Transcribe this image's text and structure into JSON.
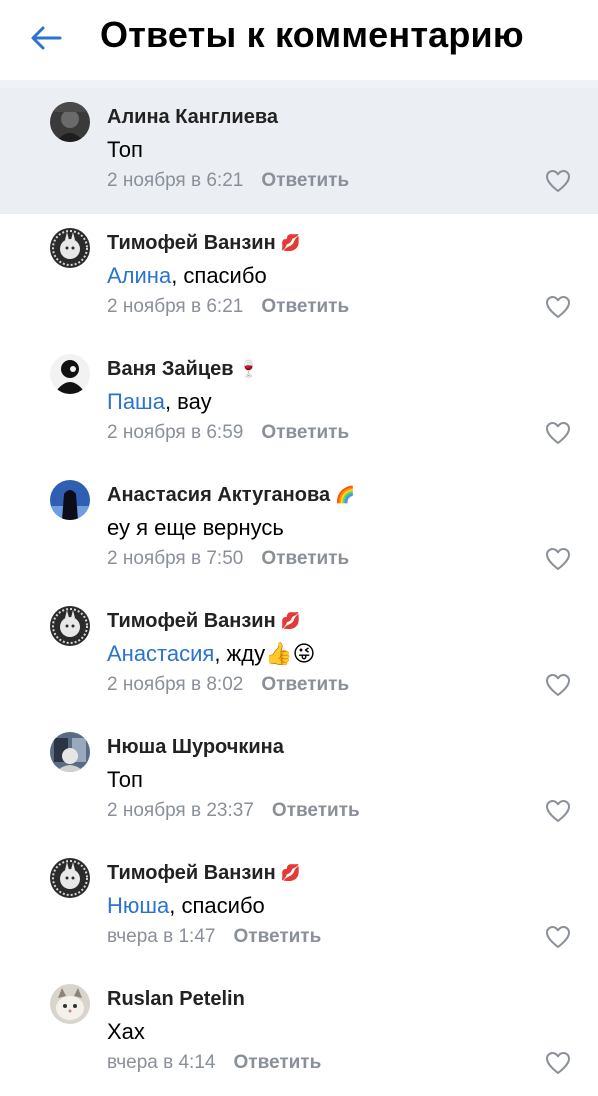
{
  "header": {
    "title": "Ответы к комментарию",
    "back_icon": "arrow-left-icon",
    "accent_color": "#2a73d1"
  },
  "comments": [
    {
      "author": "Алина Канглиева",
      "author_emoji": "",
      "mention": "",
      "text": "Топ",
      "date": "2 ноября в 6:21",
      "reply_label": "Ответить",
      "highlighted": true
    },
    {
      "author": "Тимофей Ванзин",
      "author_emoji": "💋",
      "mention": "Алина",
      "text": ", спасибо",
      "date": "2 ноября в 6:21",
      "reply_label": "Ответить",
      "highlighted": false
    },
    {
      "author": "Ваня Зайцев",
      "author_emoji": "🍷",
      "mention": "Паша",
      "text": ", вау",
      "date": "2 ноября в 6:59",
      "reply_label": "Ответить",
      "highlighted": false
    },
    {
      "author": "Анастасия Актуганова",
      "author_emoji": "🌈",
      "mention": "",
      "text": "еу я еще вернусь",
      "date": "2 ноября в 7:50",
      "reply_label": "Ответить",
      "highlighted": false
    },
    {
      "author": "Тимофей Ванзин",
      "author_emoji": "💋",
      "mention": "Анастасия",
      "text": ", жду",
      "text_emoji": "👍😜",
      "date": "2 ноября в 8:02",
      "reply_label": "Ответить",
      "highlighted": false
    },
    {
      "author": "Нюша Шурочкина",
      "author_emoji": "",
      "mention": "",
      "text": "Топ",
      "date": "2 ноября в 23:37",
      "reply_label": "Ответить",
      "highlighted": false
    },
    {
      "author": "Тимофей Ванзин",
      "author_emoji": "💋",
      "mention": "Нюша",
      "text": ", спасибо",
      "date": "вчера в 1:47",
      "reply_label": "Ответить",
      "highlighted": false
    },
    {
      "author": "Ruslan Petelin",
      "author_emoji": "",
      "mention": "",
      "text": "Хах",
      "date": "вчера в 4:14",
      "reply_label": "Ответить",
      "highlighted": false
    }
  ],
  "icons": {
    "like": "heart-outline-icon",
    "avatar": "avatar"
  }
}
